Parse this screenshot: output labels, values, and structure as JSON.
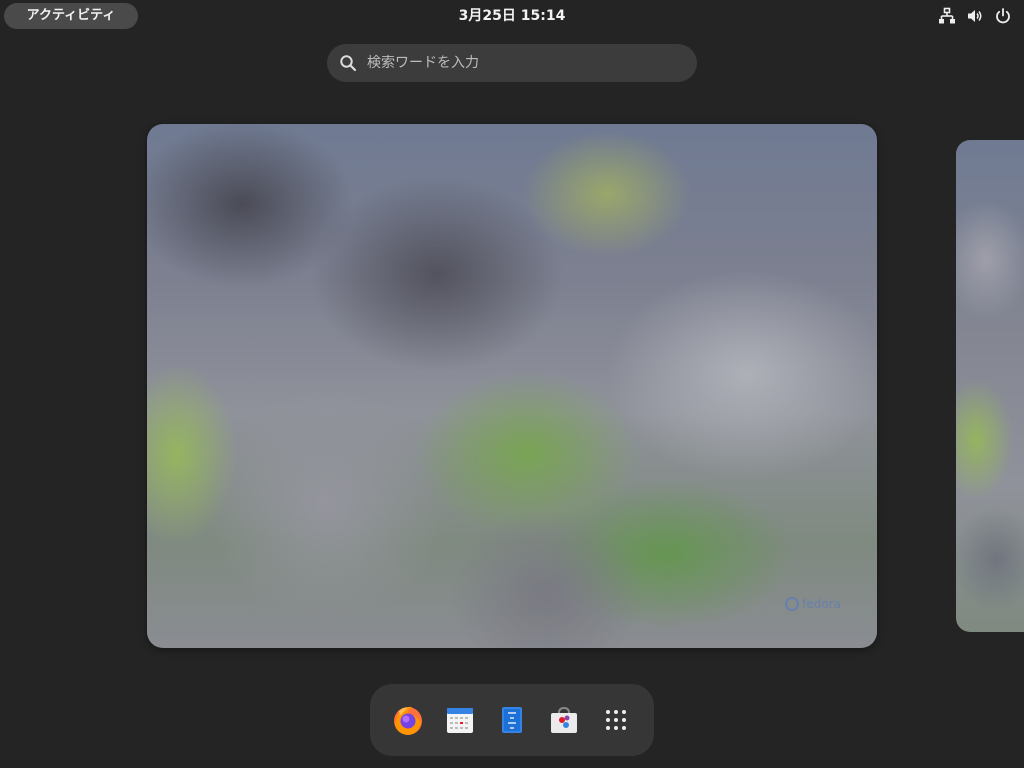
{
  "topbar": {
    "activities_label": "アクティビティ",
    "clock": "3月25日  15:14",
    "tray": {
      "network_icon": "network-wired-icon",
      "volume_icon": "volume-icon",
      "power_icon": "power-icon"
    }
  },
  "search": {
    "placeholder": "検索ワードを入力",
    "value": "",
    "icon": "search-icon"
  },
  "workspace": {
    "watermark": "fedora"
  },
  "dash": {
    "apps": [
      {
        "name": "Firefox",
        "icon": "firefox-icon"
      },
      {
        "name": "Calendar",
        "icon": "calendar-icon"
      },
      {
        "name": "Text Editor",
        "icon": "text-editor-icon"
      },
      {
        "name": "Software",
        "icon": "software-icon"
      },
      {
        "name": "Show Applications",
        "icon": "app-grid-icon"
      }
    ]
  },
  "colors": {
    "background": "#242424",
    "activities_pill": "#4a4a4a",
    "search_bg": "#3c3c3c",
    "dash_bg": "#363636"
  }
}
